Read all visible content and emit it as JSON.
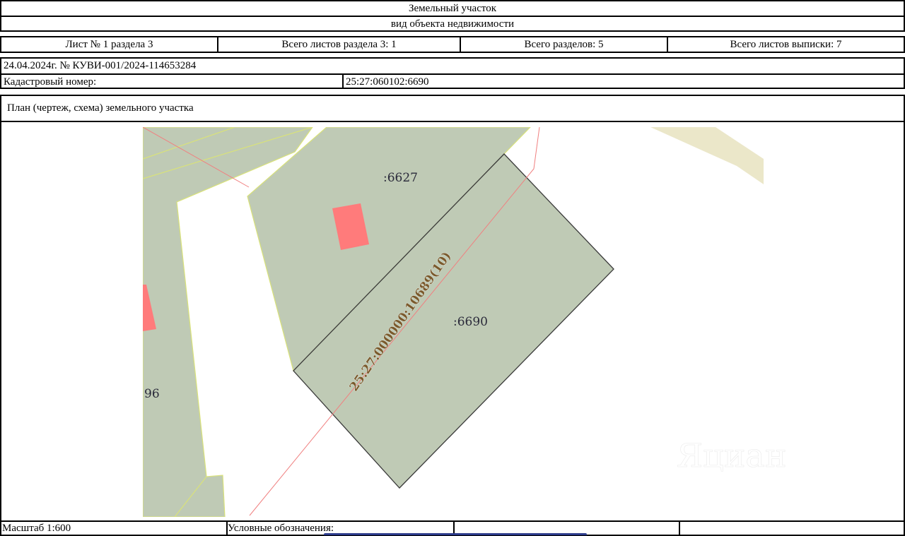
{
  "header": {
    "object_type": "Земельный участок",
    "object_type_caption": "вид объекта недвижимости"
  },
  "sheet_info": {
    "sheet": "Лист № 1 раздела 3",
    "total_sheets_section": "Всего листов раздела 3: 1",
    "total_sections": "Всего разделов: 5",
    "total_sheets_extract": "Всего листов выписки: 7"
  },
  "extract": {
    "date_number": "24.04.2024г. № КУВИ-001/2024-114653284",
    "cadastral_label": "Кадастровый номер:",
    "cadastral_value": "25:27:060102:6690"
  },
  "plan": {
    "title": "План (чертеж, схема) земельного участка",
    "labels": {
      "parcel_6627": ":6627",
      "parcel_6690": ":6690",
      "parcel_left": "96",
      "zone": "25:27:000000:10689(10)"
    },
    "watermark": "Яциан",
    "colors": {
      "parcel_fill": "#bfcab5",
      "building_fill": "#ff7b7b",
      "boundary_line": "#f08080",
      "road_fill": "#ebe7c9",
      "zone_label": "#7a5a2c"
    }
  },
  "footer": {
    "scale": "Масштаб 1:600",
    "legend": "Условные обозначения:"
  }
}
